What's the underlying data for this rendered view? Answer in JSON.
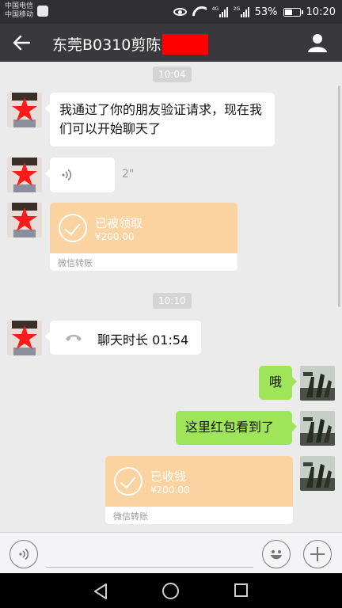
{
  "status_bar": {
    "carrier1": "中国电信",
    "carrier2": "中国移动",
    "net1": "4G",
    "net2": "2G",
    "battery": "53%",
    "battery_level": 0.53,
    "time": "10:20"
  },
  "header": {
    "title": "东莞B0310剪陈",
    "back_icon": "back-arrow-icon",
    "contact_icon": "person-icon"
  },
  "messages": {
    "time1": "10:04",
    "friend_text": "我通过了你的朋友验证请求，现在我们可以开始聊天了",
    "voice_duration": "2\"",
    "transfer1": {
      "status": "已被领取",
      "amount": "¥200.00",
      "label": "微信转账"
    },
    "time2": "10:10",
    "call_text": "聊天时长 01:54",
    "reply1": "哦",
    "reply2": "这里红包看到了",
    "transfer2": {
      "status": "已收钱",
      "amount": "¥200.00",
      "label": "微信转账"
    }
  },
  "input_bar": {
    "voice_icon": "voice-icon",
    "emoji_icon": "emoji-icon",
    "plus_icon": "plus-icon"
  },
  "colors": {
    "header": "#39393d",
    "chat_bg": "#ebebeb",
    "self_bubble": "#9fe55a",
    "transfer": "#fad3a0",
    "redaction": "#ff0000"
  }
}
